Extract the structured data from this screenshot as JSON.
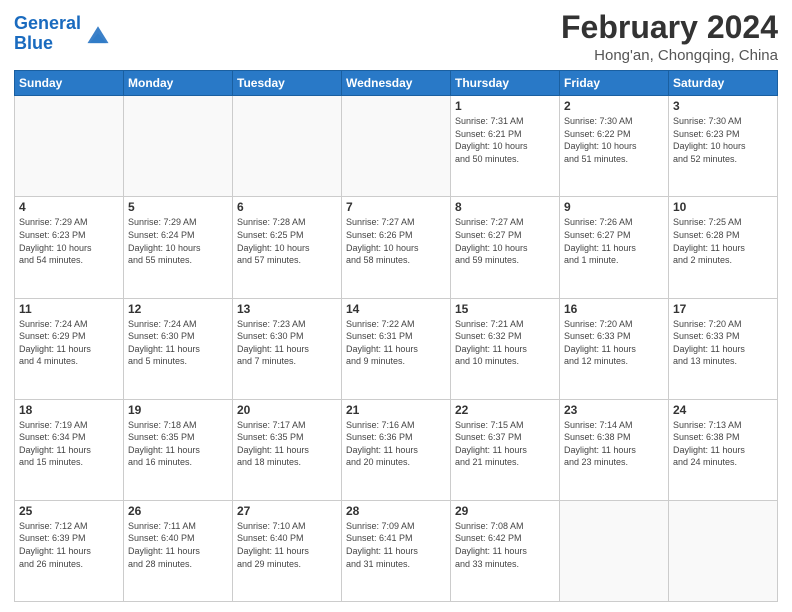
{
  "header": {
    "logo_line1": "General",
    "logo_line2": "Blue",
    "title": "February 2024",
    "subtitle": "Hong'an, Chongqing, China"
  },
  "weekdays": [
    "Sunday",
    "Monday",
    "Tuesday",
    "Wednesday",
    "Thursday",
    "Friday",
    "Saturday"
  ],
  "weeks": [
    [
      {
        "day": "",
        "info": ""
      },
      {
        "day": "",
        "info": ""
      },
      {
        "day": "",
        "info": ""
      },
      {
        "day": "",
        "info": ""
      },
      {
        "day": "1",
        "info": "Sunrise: 7:31 AM\nSunset: 6:21 PM\nDaylight: 10 hours\nand 50 minutes."
      },
      {
        "day": "2",
        "info": "Sunrise: 7:30 AM\nSunset: 6:22 PM\nDaylight: 10 hours\nand 51 minutes."
      },
      {
        "day": "3",
        "info": "Sunrise: 7:30 AM\nSunset: 6:23 PM\nDaylight: 10 hours\nand 52 minutes."
      }
    ],
    [
      {
        "day": "4",
        "info": "Sunrise: 7:29 AM\nSunset: 6:23 PM\nDaylight: 10 hours\nand 54 minutes."
      },
      {
        "day": "5",
        "info": "Sunrise: 7:29 AM\nSunset: 6:24 PM\nDaylight: 10 hours\nand 55 minutes."
      },
      {
        "day": "6",
        "info": "Sunrise: 7:28 AM\nSunset: 6:25 PM\nDaylight: 10 hours\nand 57 minutes."
      },
      {
        "day": "7",
        "info": "Sunrise: 7:27 AM\nSunset: 6:26 PM\nDaylight: 10 hours\nand 58 minutes."
      },
      {
        "day": "8",
        "info": "Sunrise: 7:27 AM\nSunset: 6:27 PM\nDaylight: 10 hours\nand 59 minutes."
      },
      {
        "day": "9",
        "info": "Sunrise: 7:26 AM\nSunset: 6:27 PM\nDaylight: 11 hours\nand 1 minute."
      },
      {
        "day": "10",
        "info": "Sunrise: 7:25 AM\nSunset: 6:28 PM\nDaylight: 11 hours\nand 2 minutes."
      }
    ],
    [
      {
        "day": "11",
        "info": "Sunrise: 7:24 AM\nSunset: 6:29 PM\nDaylight: 11 hours\nand 4 minutes."
      },
      {
        "day": "12",
        "info": "Sunrise: 7:24 AM\nSunset: 6:30 PM\nDaylight: 11 hours\nand 5 minutes."
      },
      {
        "day": "13",
        "info": "Sunrise: 7:23 AM\nSunset: 6:30 PM\nDaylight: 11 hours\nand 7 minutes."
      },
      {
        "day": "14",
        "info": "Sunrise: 7:22 AM\nSunset: 6:31 PM\nDaylight: 11 hours\nand 9 minutes."
      },
      {
        "day": "15",
        "info": "Sunrise: 7:21 AM\nSunset: 6:32 PM\nDaylight: 11 hours\nand 10 minutes."
      },
      {
        "day": "16",
        "info": "Sunrise: 7:20 AM\nSunset: 6:33 PM\nDaylight: 11 hours\nand 12 minutes."
      },
      {
        "day": "17",
        "info": "Sunrise: 7:20 AM\nSunset: 6:33 PM\nDaylight: 11 hours\nand 13 minutes."
      }
    ],
    [
      {
        "day": "18",
        "info": "Sunrise: 7:19 AM\nSunset: 6:34 PM\nDaylight: 11 hours\nand 15 minutes."
      },
      {
        "day": "19",
        "info": "Sunrise: 7:18 AM\nSunset: 6:35 PM\nDaylight: 11 hours\nand 16 minutes."
      },
      {
        "day": "20",
        "info": "Sunrise: 7:17 AM\nSunset: 6:35 PM\nDaylight: 11 hours\nand 18 minutes."
      },
      {
        "day": "21",
        "info": "Sunrise: 7:16 AM\nSunset: 6:36 PM\nDaylight: 11 hours\nand 20 minutes."
      },
      {
        "day": "22",
        "info": "Sunrise: 7:15 AM\nSunset: 6:37 PM\nDaylight: 11 hours\nand 21 minutes."
      },
      {
        "day": "23",
        "info": "Sunrise: 7:14 AM\nSunset: 6:38 PM\nDaylight: 11 hours\nand 23 minutes."
      },
      {
        "day": "24",
        "info": "Sunrise: 7:13 AM\nSunset: 6:38 PM\nDaylight: 11 hours\nand 24 minutes."
      }
    ],
    [
      {
        "day": "25",
        "info": "Sunrise: 7:12 AM\nSunset: 6:39 PM\nDaylight: 11 hours\nand 26 minutes."
      },
      {
        "day": "26",
        "info": "Sunrise: 7:11 AM\nSunset: 6:40 PM\nDaylight: 11 hours\nand 28 minutes."
      },
      {
        "day": "27",
        "info": "Sunrise: 7:10 AM\nSunset: 6:40 PM\nDaylight: 11 hours\nand 29 minutes."
      },
      {
        "day": "28",
        "info": "Sunrise: 7:09 AM\nSunset: 6:41 PM\nDaylight: 11 hours\nand 31 minutes."
      },
      {
        "day": "29",
        "info": "Sunrise: 7:08 AM\nSunset: 6:42 PM\nDaylight: 11 hours\nand 33 minutes."
      },
      {
        "day": "",
        "info": ""
      },
      {
        "day": "",
        "info": ""
      }
    ]
  ]
}
